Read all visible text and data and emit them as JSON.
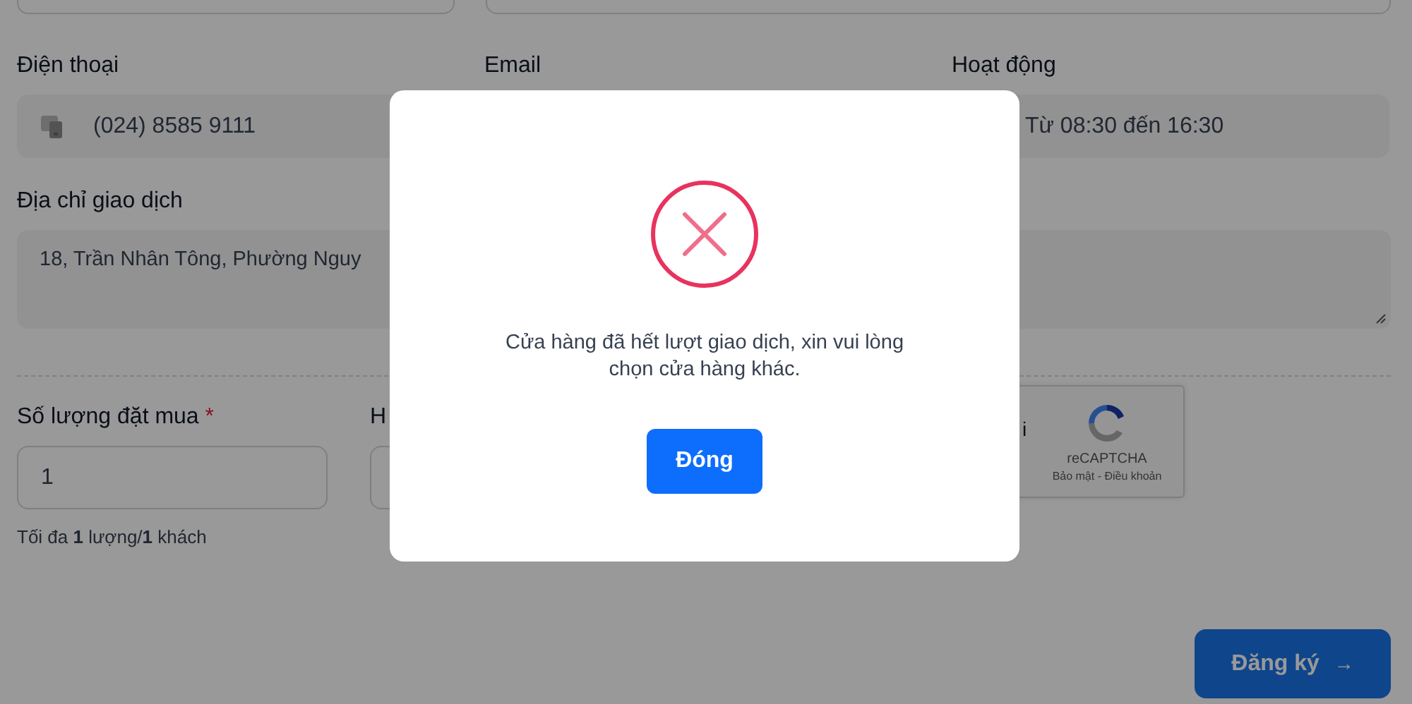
{
  "contact": {
    "phone_label": "Điện thoại",
    "phone": "(024) 8585 9111",
    "email_label": "Email",
    "hours_label": "Hoạt động",
    "hours": "Từ 08:30 đến 16:30",
    "address_label": "Địa chỉ giao dịch",
    "address": "18, Trần Nhân Tông, Phường Nguy"
  },
  "order": {
    "quantity_label": "Số lượng đặt mua",
    "required_mark": "*",
    "quantity": "1",
    "quantity_hint": "Tối đa **1** lượng/**1** khách",
    "column_2_label": "H"
  },
  "captcha": {
    "label_fragment": "i",
    "brand": "reCAPTCHA",
    "links": "Bảo mật - Điều khoản"
  },
  "submit": {
    "label": "Đăng ký",
    "arrow": "→"
  },
  "dialog": {
    "message": "Cửa hàng đã hết lượt giao dịch, xin vui lòng chọn cửa hàng khác.",
    "button": "Đóng"
  }
}
